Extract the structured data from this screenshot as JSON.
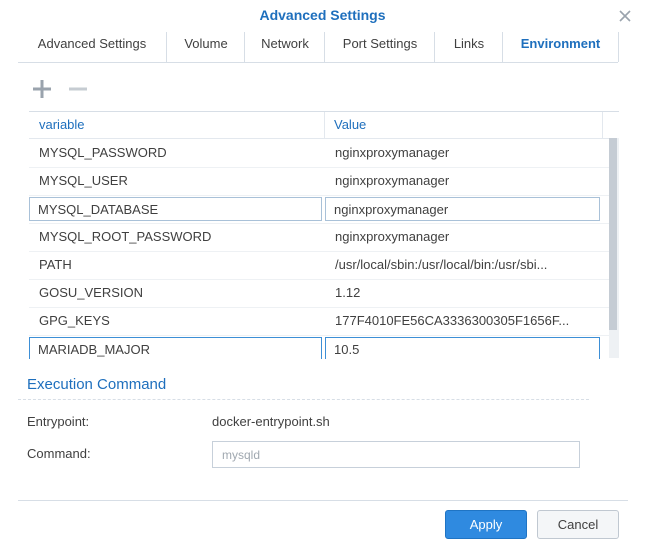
{
  "window": {
    "title": "Advanced Settings"
  },
  "tabs": [
    {
      "label": "Advanced Settings"
    },
    {
      "label": "Volume"
    },
    {
      "label": "Network"
    },
    {
      "label": "Port Settings"
    },
    {
      "label": "Links"
    },
    {
      "label": "Environment",
      "active": true
    }
  ],
  "toolbar": {
    "add_icon": "plus-icon",
    "remove_icon": "minus-icon"
  },
  "env_table": {
    "columns": [
      "variable",
      "Value"
    ],
    "rows": [
      {
        "variable": "MYSQL_PASSWORD",
        "value": "nginxproxymanager"
      },
      {
        "variable": "MYSQL_USER",
        "value": "nginxproxymanager"
      },
      {
        "variable": "MYSQL_DATABASE",
        "value": "nginxproxymanager"
      },
      {
        "variable": "MYSQL_ROOT_PASSWORD",
        "value": "nginxproxymanager"
      },
      {
        "variable": "PATH",
        "value": "/usr/local/sbin:/usr/local/bin:/usr/sbi..."
      },
      {
        "variable": "GOSU_VERSION",
        "value": "1.12"
      },
      {
        "variable": "GPG_KEYS",
        "value": "177F4010FE56CA3336300305F1656F..."
      },
      {
        "variable": "MARIADB_MAJOR",
        "value": "10.5"
      }
    ]
  },
  "execution": {
    "title": "Execution Command",
    "entrypoint_label": "Entrypoint:",
    "entrypoint_value": "docker-entrypoint.sh",
    "command_label": "Command:",
    "command_placeholder": "mysqld"
  },
  "footer": {
    "apply_label": "Apply",
    "cancel_label": "Cancel"
  },
  "colors": {
    "accent": "#1e6fbd",
    "primary_button": "#2f8ae0"
  }
}
